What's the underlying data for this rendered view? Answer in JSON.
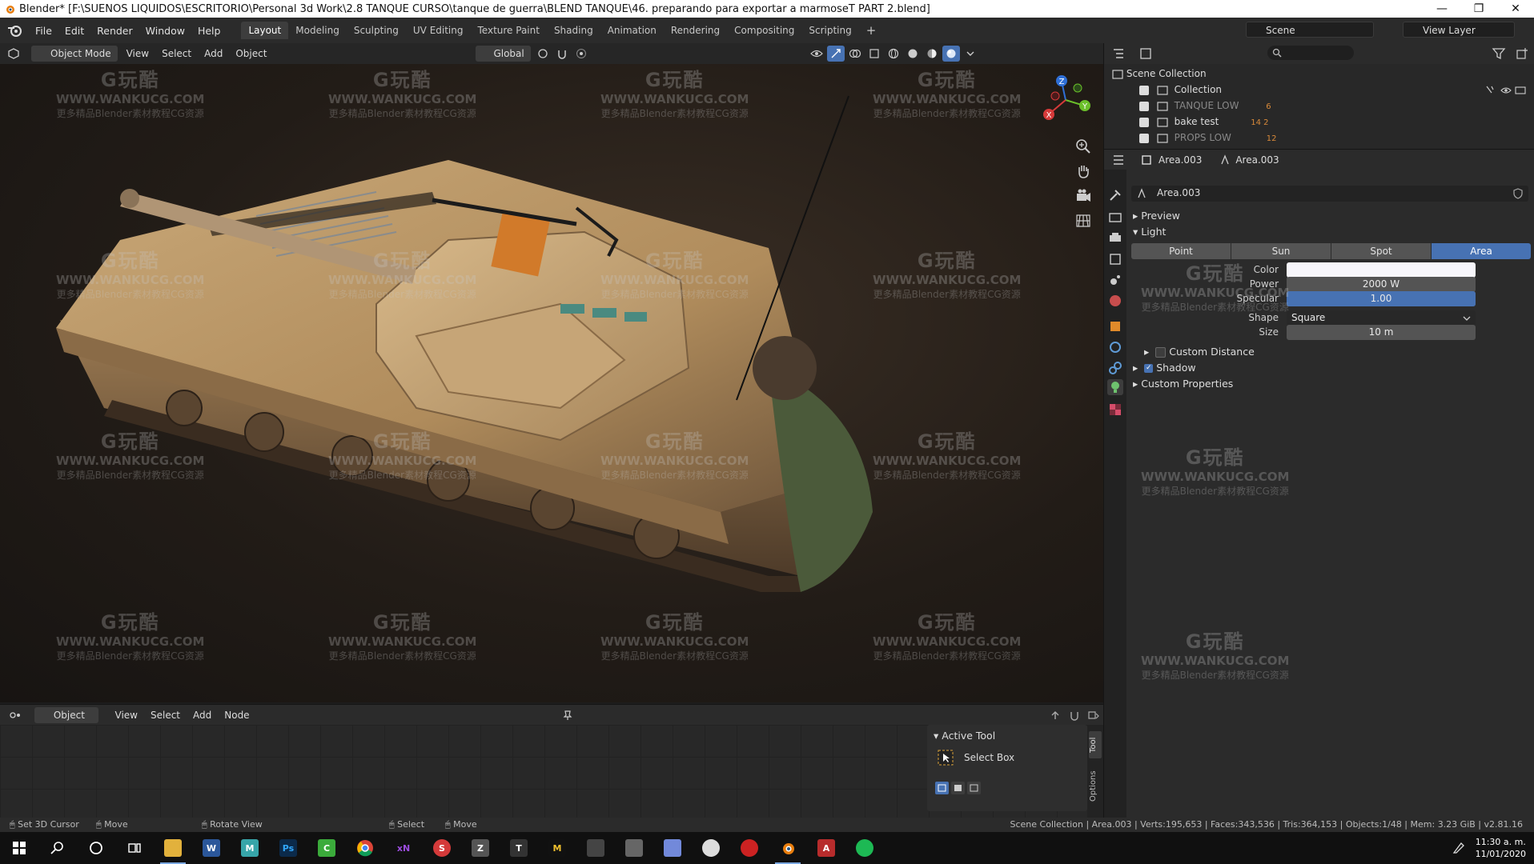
{
  "window": {
    "title": "Blender* [F:\\SUEÑOS LIQUIDOS\\ESCRITORIO\\Personal 3d Work\\2.8 TANQUE CURSO\\tanque de guerra\\BLEND TANQUE\\46. preparando para exportar a marmoseT PART 2.blend]",
    "minimize": "—",
    "maximize": "❐",
    "close": "✕"
  },
  "menu": [
    "File",
    "Edit",
    "Render",
    "Window",
    "Help"
  ],
  "workspaces": [
    {
      "label": "Layout",
      "active": true
    },
    {
      "label": "Modeling"
    },
    {
      "label": "Sculpting"
    },
    {
      "label": "UV Editing"
    },
    {
      "label": "Texture Paint"
    },
    {
      "label": "Shading"
    },
    {
      "label": "Animation"
    },
    {
      "label": "Rendering"
    },
    {
      "label": "Compositing"
    },
    {
      "label": "Scripting"
    }
  ],
  "add_workspace": "+",
  "scene": {
    "name": "Scene",
    "view_layer": "View Layer"
  },
  "viewport_header": {
    "mode": "Object Mode",
    "menus": [
      "View",
      "Select",
      "Add",
      "Object"
    ],
    "orientation": "Global"
  },
  "gizmo": {
    "z": "Z",
    "y": "Y",
    "x": "X"
  },
  "watermark": {
    "logo": "G玩酷",
    "url": "WWW.WANKUCG.COM",
    "sub": "更多精品Blender素材教程CG资源"
  },
  "node_header": {
    "mode": "Object",
    "menus": [
      "View",
      "Select",
      "Add",
      "Node"
    ]
  },
  "active_tool": {
    "title": "Active Tool",
    "tool": "Select Box",
    "tab_tool": "Tool",
    "tab_options": "Options"
  },
  "outliner": {
    "root": "Scene Collection",
    "rows": [
      {
        "name": "Collection",
        "extra": ""
      },
      {
        "name": "TANQUE LOW",
        "extra": "6"
      },
      {
        "name": "bake test",
        "extra": "14 2"
      },
      {
        "name": "PROPS LOW",
        "extra": "12"
      }
    ]
  },
  "properties": {
    "header_object": "Area.003",
    "header_data": "Area.003",
    "datablock": "Area.003",
    "sections": {
      "preview": "Preview",
      "light": "Light",
      "custom_distance": "Custom Distance",
      "shadow": "Shadow",
      "custom_properties": "Custom Properties"
    },
    "light_types": [
      {
        "label": "Point"
      },
      {
        "label": "Sun"
      },
      {
        "label": "Spot"
      },
      {
        "label": "Area",
        "active": true
      }
    ],
    "labels": {
      "color": "Color",
      "power": "Power",
      "specular": "Specular",
      "shape": "Shape",
      "size": "Size"
    },
    "values": {
      "power": "2000 W",
      "specular": "1.00",
      "shape": "Square",
      "size": "10 m"
    },
    "specular_fill": 1.0
  },
  "status": {
    "left": [
      "Set 3D Cursor",
      "Move",
      "Rotate View",
      "Select",
      "Move"
    ],
    "right": "Scene Collection | Area.003 | Verts:195,653 | Faces:343,536 | Tris:364,153 | Objects:1/48 | Mem: 3.23 GiB | v2.81.16"
  },
  "taskbar": {
    "time": "11:30 a. m.",
    "date": "11/01/2020"
  },
  "colors": {
    "accent": "#4772b3",
    "selected_tab": "#3d3d3d",
    "panel": "#2b2b2b"
  }
}
